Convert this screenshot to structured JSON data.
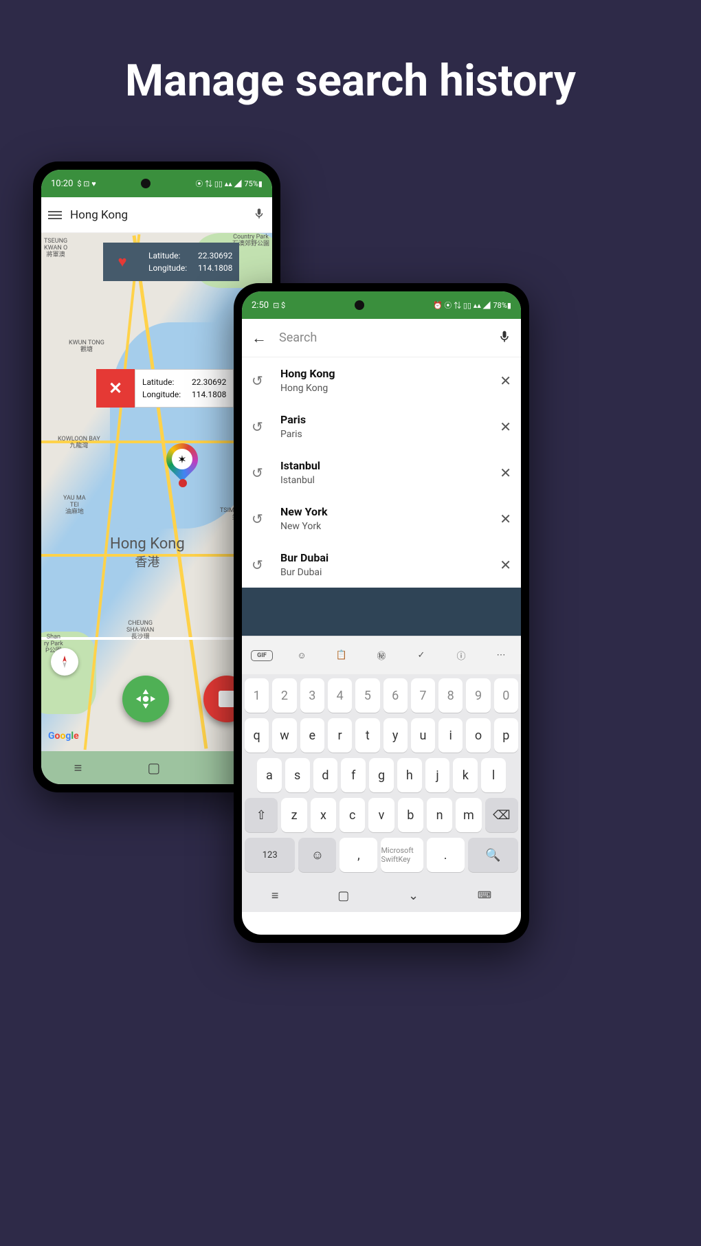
{
  "headline": "Manage search history",
  "phone1": {
    "statusbar": {
      "time": "10:20",
      "left_icons": "$ ⊡ ♥",
      "right_icons": "⦿ ⇅ ▯▯ ▴▴ ◢",
      "battery": "75%▮"
    },
    "search_query": "Hong Kong",
    "info": {
      "lat_label": "Latitude:",
      "lat_value": "22.30692",
      "lng_label": "Longitude:",
      "lng_value": "114.1808"
    },
    "city": {
      "en": "Hong Kong",
      "local": "香港"
    },
    "map_labels": {
      "tseung_kwan_o": "TSEUNG\nKWAN O\n將軍澳",
      "kwun_tong": "KWUN TONG\n觀塘",
      "kowloon_bay": "KOWLOON BAY\n九龍灣",
      "yau_ma_tei": "YAU MA\nTEI\n油麻地",
      "tsim_sha_tsui": "TSIM SHA-TSUI\n尖沙咀",
      "cheung_sha_wan": "CHEUNG\nSHA-WAN\n長沙環",
      "country_park": "Country Park\n石澳郊野公園",
      "shan_park": "Shan\nry Park\nP公園"
    },
    "google": [
      "G",
      "o",
      "o",
      "g",
      "l",
      "e"
    ]
  },
  "phone2": {
    "statusbar": {
      "time": "2:50",
      "left_icons": "⊡ $",
      "right_icons": "⏰ ⦿ ⇅ ▯▯ ▴▴ ◢",
      "battery": "78%▮"
    },
    "search_placeholder": "Search",
    "history": [
      {
        "title": "Hong Kong",
        "subtitle": "Hong Kong"
      },
      {
        "title": "Paris",
        "subtitle": "Paris"
      },
      {
        "title": "Istanbul",
        "subtitle": "Istanbul"
      },
      {
        "title": "New York",
        "subtitle": "New York"
      },
      {
        "title": "Bur Dubai",
        "subtitle": "Bur Dubai"
      }
    ],
    "toolbar_labels": {
      "gif": "GIF"
    },
    "keyboard": {
      "row_num": [
        "1",
        "2",
        "3",
        "4",
        "5",
        "6",
        "7",
        "8",
        "9",
        "0"
      ],
      "row1": [
        "q",
        "w",
        "e",
        "r",
        "t",
        "y",
        "u",
        "i",
        "o",
        "p"
      ],
      "row2": [
        "a",
        "s",
        "d",
        "f",
        "g",
        "h",
        "j",
        "k",
        "l"
      ],
      "row3": [
        "z",
        "x",
        "c",
        "v",
        "b",
        "n",
        "m"
      ],
      "key_123": "123",
      "key_comma": ",",
      "key_space": "Microsoft SwiftKey",
      "key_period": "."
    }
  }
}
